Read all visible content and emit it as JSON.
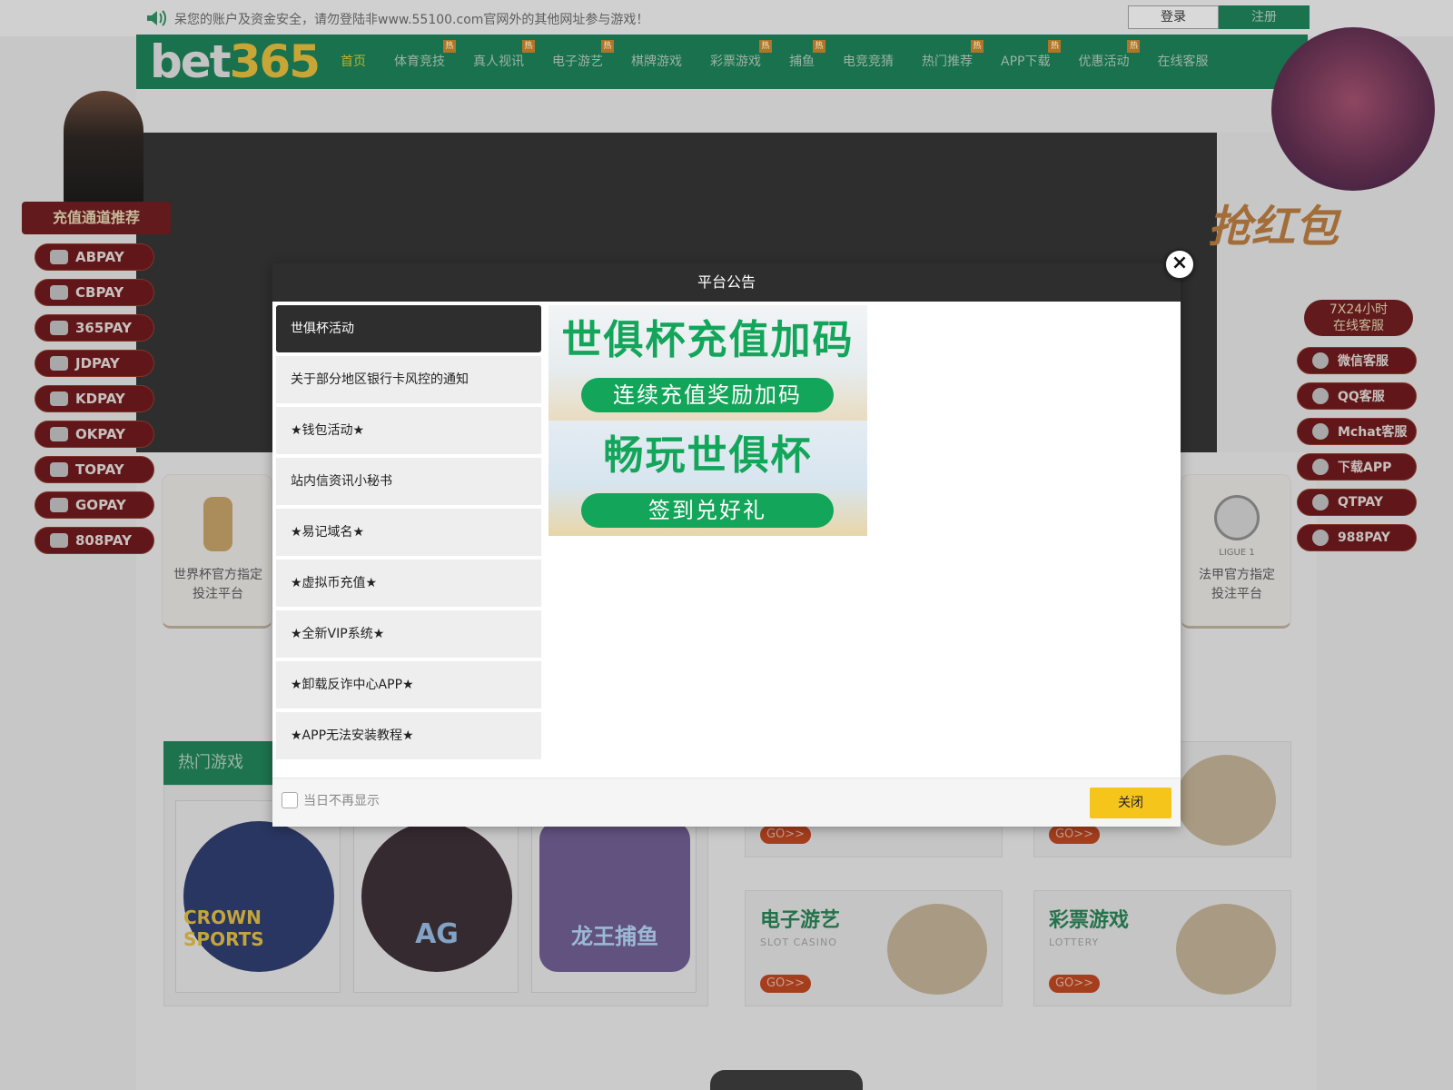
{
  "notice": {
    "text": "呆您的账户及资金安全，请勿登陆非www.55100.com官网外的其他网址参与游戏！"
  },
  "auth": {
    "login": "登录",
    "register": "注册"
  },
  "logo": {
    "part1": "bet",
    "part2": "365"
  },
  "nav": {
    "items": [
      {
        "label": "首页",
        "hot": ""
      },
      {
        "label": "体育竞技",
        "hot": "热"
      },
      {
        "label": "真人视讯",
        "hot": "热"
      },
      {
        "label": "电子游艺",
        "hot": "热"
      },
      {
        "label": "棋牌游戏",
        "hot": ""
      },
      {
        "label": "彩票游戏",
        "hot": "热"
      },
      {
        "label": "捕鱼",
        "hot": "热"
      },
      {
        "label": "电竞竞猜",
        "hot": ""
      },
      {
        "label": "热门推荐",
        "hot": "热"
      },
      {
        "label": "APP下载",
        "hot": "热"
      },
      {
        "label": "优惠活动",
        "hot": "热"
      },
      {
        "label": "在线客服",
        "hot": ""
      }
    ]
  },
  "left_panel": {
    "ribbon": "充值通道推荐",
    "items": [
      "ABPAY",
      "CBPAY",
      "365PAY",
      "JDPAY",
      "KDPAY",
      "OKPAY",
      "TOPAY",
      "GOPAY",
      "808PAY"
    ]
  },
  "right_panel": {
    "promo_text": "抢红包",
    "service_ribbon_line1": "7X24小时",
    "service_ribbon_line2": "在线客服",
    "items": [
      "微信客服",
      "QQ客服",
      "Mchat客服",
      "下载APP",
      "QTPAY",
      "988PAY"
    ]
  },
  "sponsors": {
    "left": {
      "line1": "世界杯官方指定",
      "line2": "投注平台"
    },
    "right": {
      "line1": "法甲官方指定",
      "line2": "投注平台",
      "badge": "LIGUE 1"
    }
  },
  "hot_games": {
    "title": "热门游戏",
    "games": [
      "CROWN SPORTS",
      "AG",
      "龙王捕鱼"
    ]
  },
  "categories": [
    {
      "title": "电子游艺",
      "sub": "SLOT CASINO",
      "go": "GO>>"
    },
    {
      "title": "彩票游戏",
      "sub": "LOTTERY",
      "go": "GO>>"
    }
  ],
  "partial_go": [
    "GO>>",
    "GO>>"
  ],
  "modal": {
    "title": "平台公告",
    "close_x": "×",
    "tabs": [
      "世俱杯活动",
      "关于部分地区银行卡风控的通知",
      "★钱包活动★",
      "站内信资讯小秘书",
      "★易记域名★",
      "★虚拟币充值★",
      "★全新VIP系统★",
      "★卸载反诈中心APP★",
      "★APP无法安装教程★"
    ],
    "promo": [
      {
        "title": "世俱杯充值加码",
        "pill": "连续充值奖励加码"
      },
      {
        "title": "畅玩世俱杯",
        "pill": "签到兑好礼"
      }
    ],
    "dont_show": "当日不再显示",
    "close_button": "关闭"
  },
  "colors": {
    "brand_green": "#1c7b54",
    "modal_header": "#2e2e2e",
    "promo_green": "#13a55a",
    "close_yellow": "#f5c51c"
  }
}
